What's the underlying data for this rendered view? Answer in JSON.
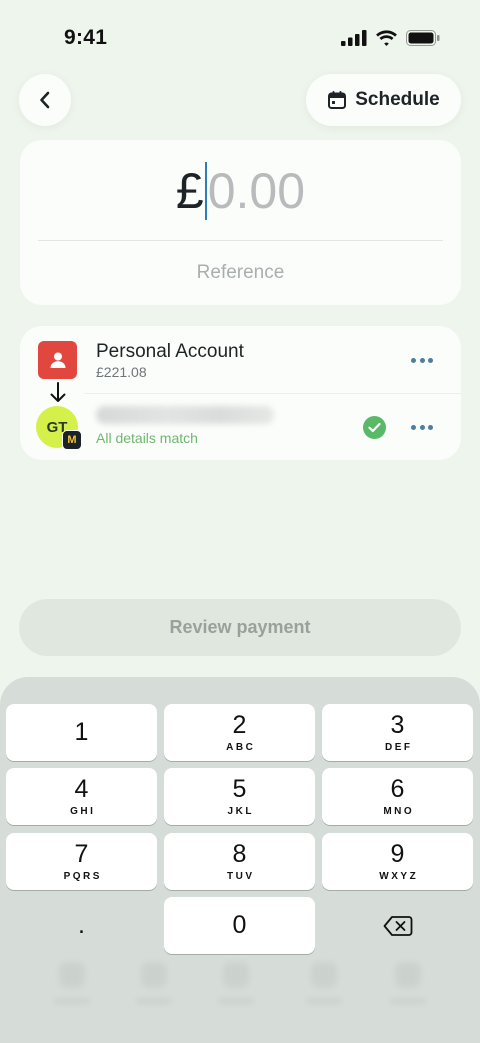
{
  "status_bar": {
    "time": "9:41"
  },
  "header": {
    "schedule_label": "Schedule"
  },
  "amount": {
    "currency": "£",
    "placeholder": "0.00"
  },
  "reference": {
    "placeholder": "Reference"
  },
  "from_account": {
    "name": "Personal Account",
    "balance": "£221.08"
  },
  "to_account": {
    "initials": "GT",
    "badge_letter": "M",
    "status_text": "All details match"
  },
  "review_button": {
    "label": "Review payment"
  },
  "keypad": {
    "keys": [
      {
        "digit": "1",
        "letters": ""
      },
      {
        "digit": "2",
        "letters": "ABC"
      },
      {
        "digit": "3",
        "letters": "DEF"
      },
      {
        "digit": "4",
        "letters": "GHI"
      },
      {
        "digit": "5",
        "letters": "JKL"
      },
      {
        "digit": "6",
        "letters": "MNO"
      },
      {
        "digit": "7",
        "letters": "PQRS"
      },
      {
        "digit": "8",
        "letters": "TUV"
      },
      {
        "digit": "9",
        "letters": "WXYZ"
      },
      {
        "digit": ".",
        "letters": ""
      },
      {
        "digit": "0",
        "letters": ""
      }
    ]
  },
  "colors": {
    "background": "#eef5ec",
    "from_icon": "#e1473f",
    "to_avatar": "#d6f04a",
    "match_green": "#5ab967",
    "caret": "#2e7db8",
    "more_dots": "#4d7e9e"
  },
  "icons": {
    "back": "chevron-left-icon",
    "schedule": "calendar-icon",
    "from": "person-icon",
    "more": "more-horizontal-icon",
    "verified": "check-circle-icon",
    "backspace": "backspace-icon"
  }
}
